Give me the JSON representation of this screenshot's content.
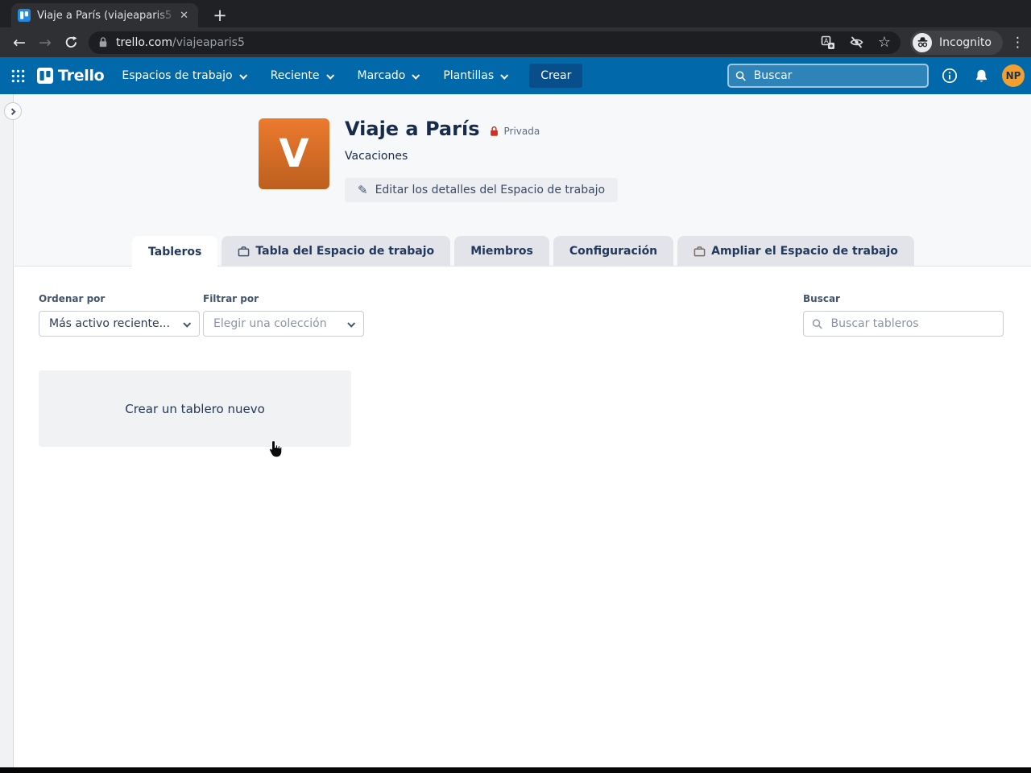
{
  "browser": {
    "tab": {
      "title": "Viaje a París (viajeaparis5",
      "close_glyph": "✕",
      "new_tab_glyph": "+"
    },
    "toolbar": {
      "back_glyph": "←",
      "forward_glyph": "→",
      "url_host": "trello.com",
      "url_path": "/viajeaparis5",
      "incognito_label": "Incognito",
      "menu_glyph": "⋮",
      "star_glyph": "☆"
    }
  },
  "appbar": {
    "logo_text": "Trello",
    "nav": [
      {
        "label": "Espacios de trabajo"
      },
      {
        "label": "Reciente"
      },
      {
        "label": "Marcado"
      },
      {
        "label": "Plantillas"
      }
    ],
    "create_label": "Crear",
    "search_placeholder": "Buscar",
    "avatar_initials": "NP"
  },
  "workspace": {
    "initial": "V",
    "title": "Viaje a París",
    "visibility": "Privada",
    "description": "Vacaciones",
    "edit_button": "Editar los detalles del Espacio de trabajo",
    "edit_icon_glyph": "✎"
  },
  "tabs": [
    {
      "label": "Tableros"
    },
    {
      "label": "Tabla del Espacio de trabajo"
    },
    {
      "label": "Miembros"
    },
    {
      "label": "Configuración"
    },
    {
      "label": "Ampliar el Espacio de trabajo"
    }
  ],
  "filters": {
    "sort_label": "Ordenar por",
    "sort_value": "Más activo reciente...",
    "filter_label": "Filtrar por",
    "filter_placeholder": "Elegir una colección",
    "search_label": "Buscar",
    "search_placeholder": "Buscar tableros"
  },
  "content": {
    "create_board_tile": "Crear un tablero nuevo"
  },
  "colors": {
    "appbar_blue": "#0168a9",
    "create_button_blue": "#074e8a",
    "avatar_orange_top": "#ec7a2e",
    "avatar_orange_bottom": "#bd5f1f",
    "member_avatar": "#f0a032",
    "private_lock_red": "#ca3521",
    "page_text_navy": "#172b4d",
    "chrome_dark": "#202124"
  }
}
